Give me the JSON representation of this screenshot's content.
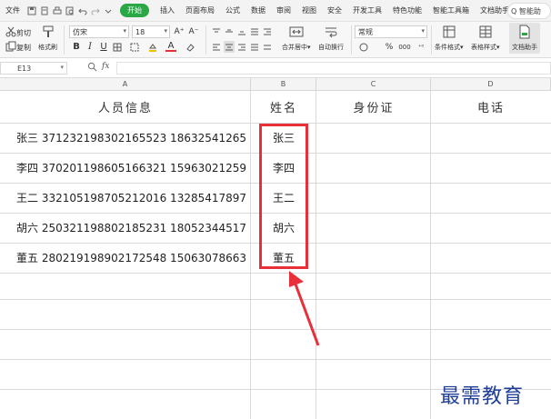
{
  "menubar": {
    "file": "文件",
    "active_tab": "开始",
    "tabs": [
      "插入",
      "页面布局",
      "公式",
      "数据",
      "审阅",
      "视图",
      "安全",
      "开发工具",
      "特色功能",
      "智能工具箱",
      "文档助手"
    ],
    "search": "Q 智能助"
  },
  "ribbon": {
    "cut": "剪切",
    "copy": "复制",
    "format_painter": "格式刷",
    "font_name": "仿宋",
    "font_size": "18",
    "grow_font": "A⁺",
    "shrink_font": "A⁻",
    "bold": "B",
    "italic": "I",
    "underline": "U",
    "font_color_letter": "A",
    "merge_center": "合并居中",
    "wrap_text": "自动换行",
    "number_format": "常规",
    "percent": "%",
    "thousands": "000",
    "conditional_format": "条件格式",
    "table_style": "表格样式",
    "doc_helper": "文档助手"
  },
  "formula_bar": {
    "cell_ref": "E13",
    "fx": "fx"
  },
  "columns": [
    "A",
    "B",
    "C",
    "D"
  ],
  "headers": {
    "a": "人员信息",
    "b": "姓名",
    "c": "身份证",
    "d": "电话"
  },
  "rows": [
    {
      "info": "张三  371232198302165523  18632541265",
      "name": "张三"
    },
    {
      "info": "李四  370201198605166321  15963021259",
      "name": "李四"
    },
    {
      "info": "王二  332105198705212016  13285417897",
      "name": "王二"
    },
    {
      "info": "胡六  250321198802185231  18052344517",
      "name": "胡六"
    },
    {
      "info": "董五  280219198902172548  15063078663",
      "name": "董五"
    }
  ],
  "watermark": "最需教育",
  "colors": {
    "accent_green": "#2aa846",
    "highlight_red": "#e8303a",
    "watermark_blue": "#1f3f98"
  }
}
